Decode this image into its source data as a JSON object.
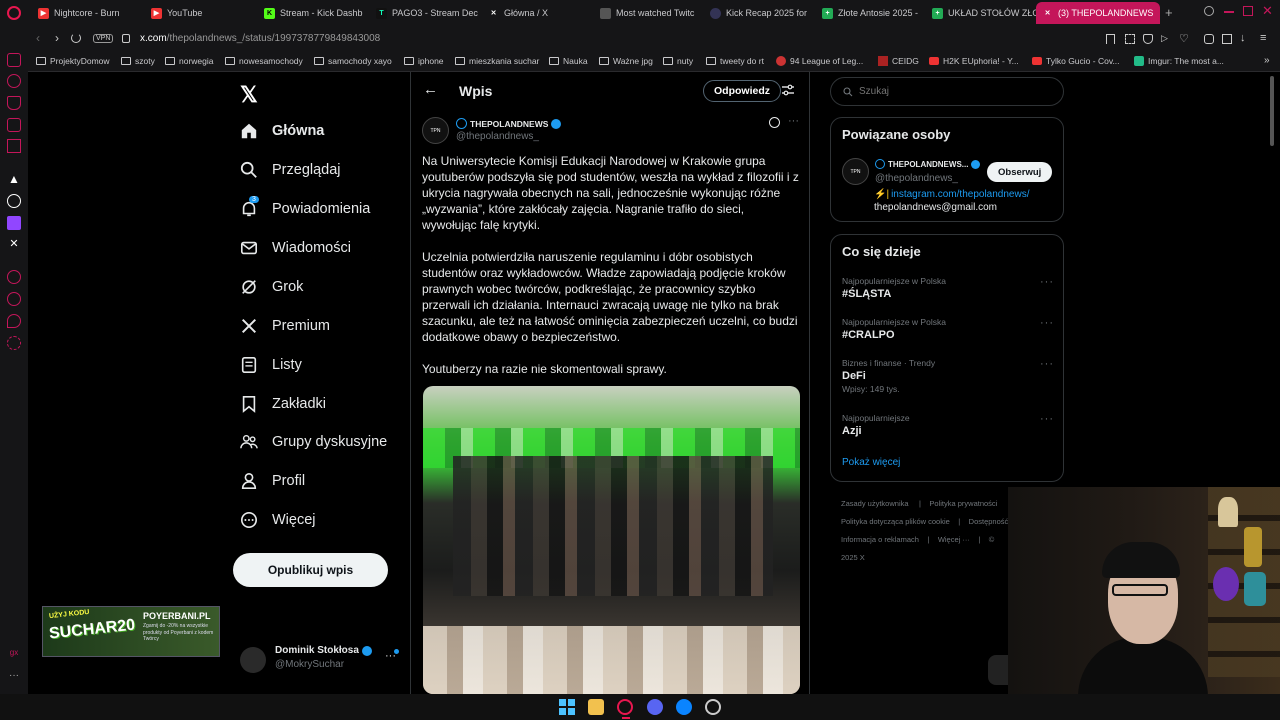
{
  "tabs": [
    {
      "label": "Nightcore - Burn",
      "color": "#e33"
    },
    {
      "label": "YouTube",
      "color": "#e33"
    },
    {
      "label": "Stream - Kick Dashb",
      "color": "#53fc18"
    },
    {
      "label": "PAGO3 - Stream Dec",
      "color": "#1fb"
    },
    {
      "label": "Główna / X",
      "color": "#000"
    },
    {
      "label": "Most watched Twitc",
      "color": "#888"
    },
    {
      "label": "Kick Recap 2025 for",
      "color": "#6b8"
    },
    {
      "label": "Złote Antosie 2025 -",
      "color": "#2a5"
    },
    {
      "label": "UKŁAD STOŁÓW ZŁO",
      "color": "#2a5"
    },
    {
      "label": "(3) THEPOLANDNEWS",
      "color": "#000"
    }
  ],
  "address": {
    "vpn": "VPN",
    "domain": "x.com",
    "path": "/thepolandnews_/status/1997378779849843008"
  },
  "bookmarks": [
    "ProjektyDomow",
    "szoty",
    "norwegia",
    "nowesamochody",
    "samochody xayo",
    "iphone",
    "mieszkania suchar",
    "Nauka",
    "Ważne jpg",
    "nuty",
    "tweety do rt",
    "94 League of Leg...",
    "CEIDG",
    "H2K EUphoria! - Y...",
    "Tylko Gucio - Cov...",
    "Imgur: The most a..."
  ],
  "nav": {
    "items": [
      "Główna",
      "Przeglądaj",
      "Powiadomienia",
      "Wiadomości",
      "Grok",
      "Premium",
      "Listy",
      "Zakładki",
      "Grupy dyskusyjne",
      "Profil",
      "Więcej"
    ],
    "notification_count": "3",
    "post_button": "Opublikuj wpis"
  },
  "account": {
    "name": "Dominik Stokłosa",
    "handle": "@MokrySuchar"
  },
  "promo": {
    "line1": "UŻYJ KODU",
    "code": "SUCHAR20",
    "brand": "POYERBANI.PL",
    "desc": "Zgarnij do -20% na wszystkie produkty od Poyerbani z kodem Twórcy"
  },
  "post": {
    "header_title": "Wpis",
    "reply_button": "Odpowiedz",
    "author_name": "THEPOLANDNEWS",
    "author_handle": "@thepolandnews_",
    "avatar_text": "TPN",
    "paragraph1": "Na Uniwersytecie Komisji Edukacji Narodowej w Krakowie grupa youtuberów podszyła się pod studentów, weszła na wykład z filozofii i z ukrycia nagrywała obecnych na sali, jednocześnie wykonując różne „wyzwania”, które zakłócały zajęcia. Nagranie trafiło do sieci, wywołując falę krytyki.",
    "paragraph2": "Uczelnia potwierdziła naruszenie regulaminu i dóbr osobistych studentów oraz wykładowców. Władze zapowiadają podjęcie kroków prawnych wobec twórców, podkreślając, że pracownicy szybko przerwali ich działania. Internauci zwracają uwagę nie tylko na brak szacunku, ale też na łatwość ominięcia zabezpieczeń uczelni, co budzi dodatkowe obawy o bezpieczeństwo.",
    "paragraph3": "Youtuberzy na razie nie skomentowali sprawy."
  },
  "search": {
    "placeholder": "Szukaj"
  },
  "related": {
    "title": "Powiązane osoby",
    "name": "THEPOLANDNEWS...",
    "handle": "@thepolandnews_",
    "follow_button": "Obserwuj",
    "bio_link": "instagram.com/thepolandnews/",
    "bio_email": "thepolandnews@gmail.com"
  },
  "trends": {
    "title": "Co się dzieje",
    "items": [
      {
        "meta": "Najpopularniejsze w Polska",
        "name": "#ŚLĄSTA",
        "count": ""
      },
      {
        "meta": "Najpopularniejsze w Polska",
        "name": "#CRALPO",
        "count": ""
      },
      {
        "meta": "Biznes i finanse · Trendy",
        "name": "DeFi",
        "count": "Wpisy: 149 tys."
      },
      {
        "meta": "Najpopularniejsze",
        "name": "Azji",
        "count": ""
      }
    ],
    "show_more": "Pokaż więcej"
  },
  "footer": {
    "links": [
      "Zasady użytkownika",
      "Polityka prywatności",
      "Polityka dotycząca plików cookie",
      "Dostępność",
      "Informacja o reklamach",
      "Więcej ···",
      "© 2025 X"
    ]
  },
  "colors": {
    "accent": "#1d9bf0",
    "opera_red": "#c4165a",
    "border": "#2f3336",
    "muted": "#71767b"
  }
}
